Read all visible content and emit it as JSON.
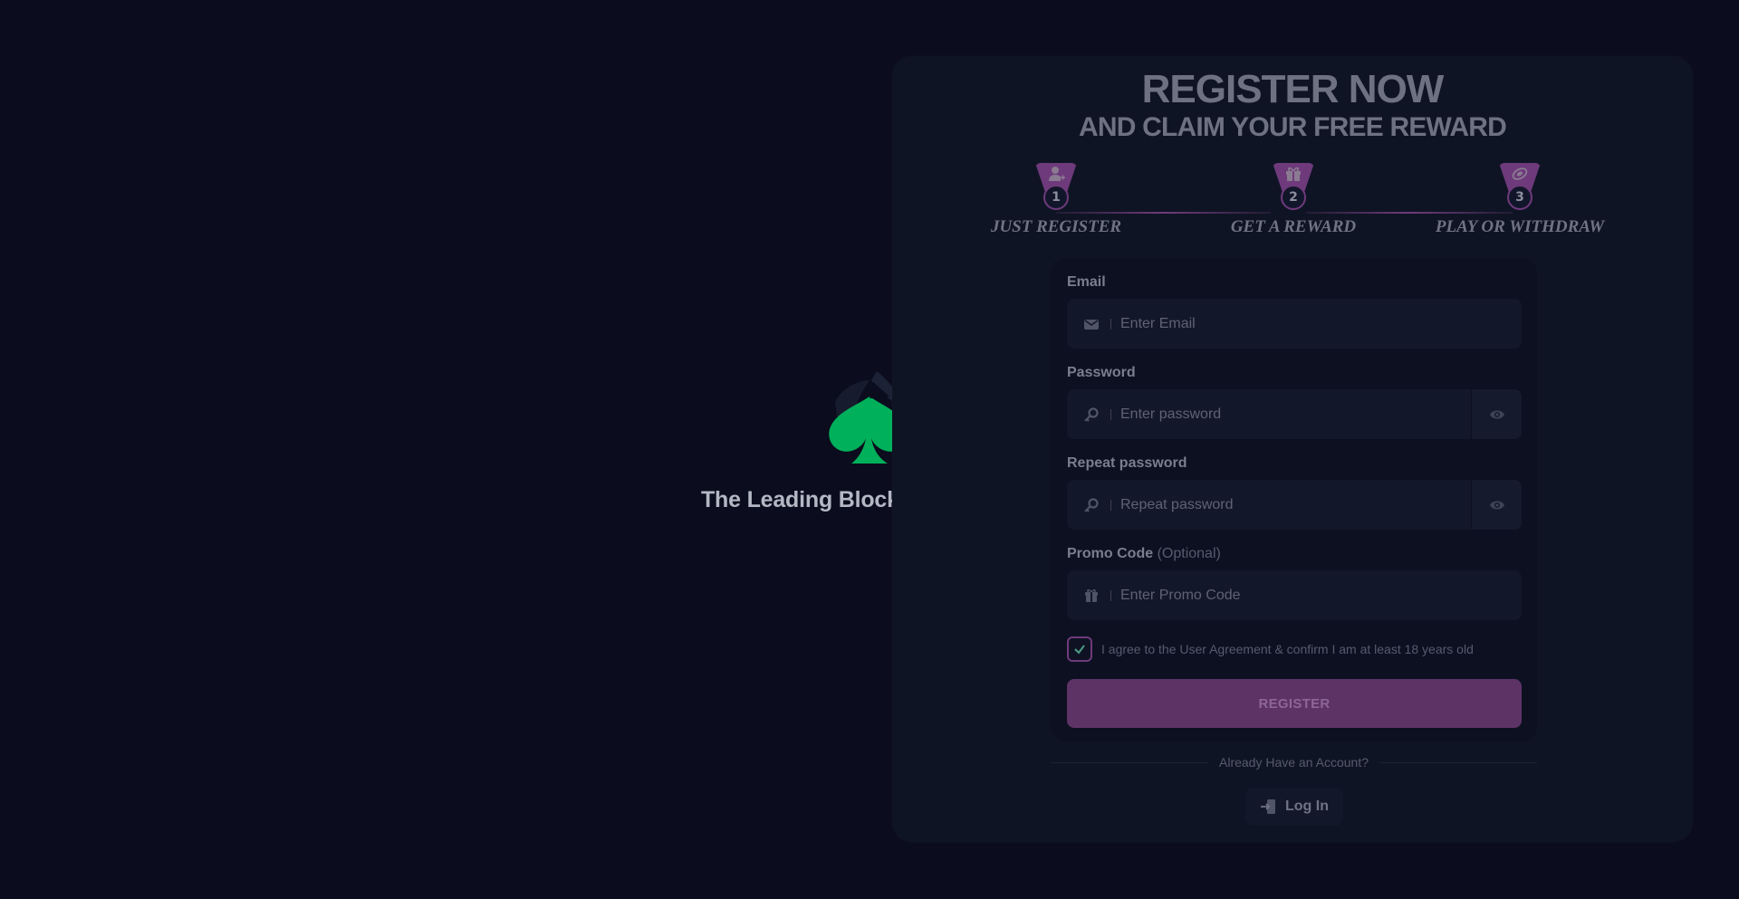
{
  "splash": {
    "tagline": "The Leading Blockchain Casino",
    "logo_icon": "spade-logo-icon",
    "logo_color": "#00b05a"
  },
  "modal": {
    "title_line1": "REGISTER NOW",
    "title_line2": "AND CLAIM YOUR FREE REWARD",
    "steps": [
      {
        "number": "1",
        "label": "JUST REGISTER",
        "icon": "user-add-icon"
      },
      {
        "number": "2",
        "label": "GET A REWARD",
        "icon": "gift-icon"
      },
      {
        "number": "3",
        "label": "PLAY OR WITHDRAW",
        "icon": "coins-icon"
      }
    ],
    "form": {
      "email": {
        "label": "Email",
        "placeholder": "Enter Email",
        "value": ""
      },
      "password": {
        "label": "Password",
        "placeholder": "Enter password",
        "value": ""
      },
      "repeat_password": {
        "label": "Repeat password",
        "placeholder": "Repeat password",
        "value": ""
      },
      "promo": {
        "label": "Promo Code",
        "optional": "(Optional)",
        "placeholder": "Enter Promo Code",
        "value": ""
      },
      "agree": {
        "checked": true,
        "text": "I agree to the User Agreement & confirm I am at least 18 years old"
      },
      "register_label": "REGISTER"
    },
    "already_text": "Already Have an Account?",
    "login_label": "Log In"
  },
  "colors": {
    "background": "#0b0c1d",
    "panel": "#0f1424",
    "accent": "#6e3a7b",
    "button": "#5d3366"
  }
}
